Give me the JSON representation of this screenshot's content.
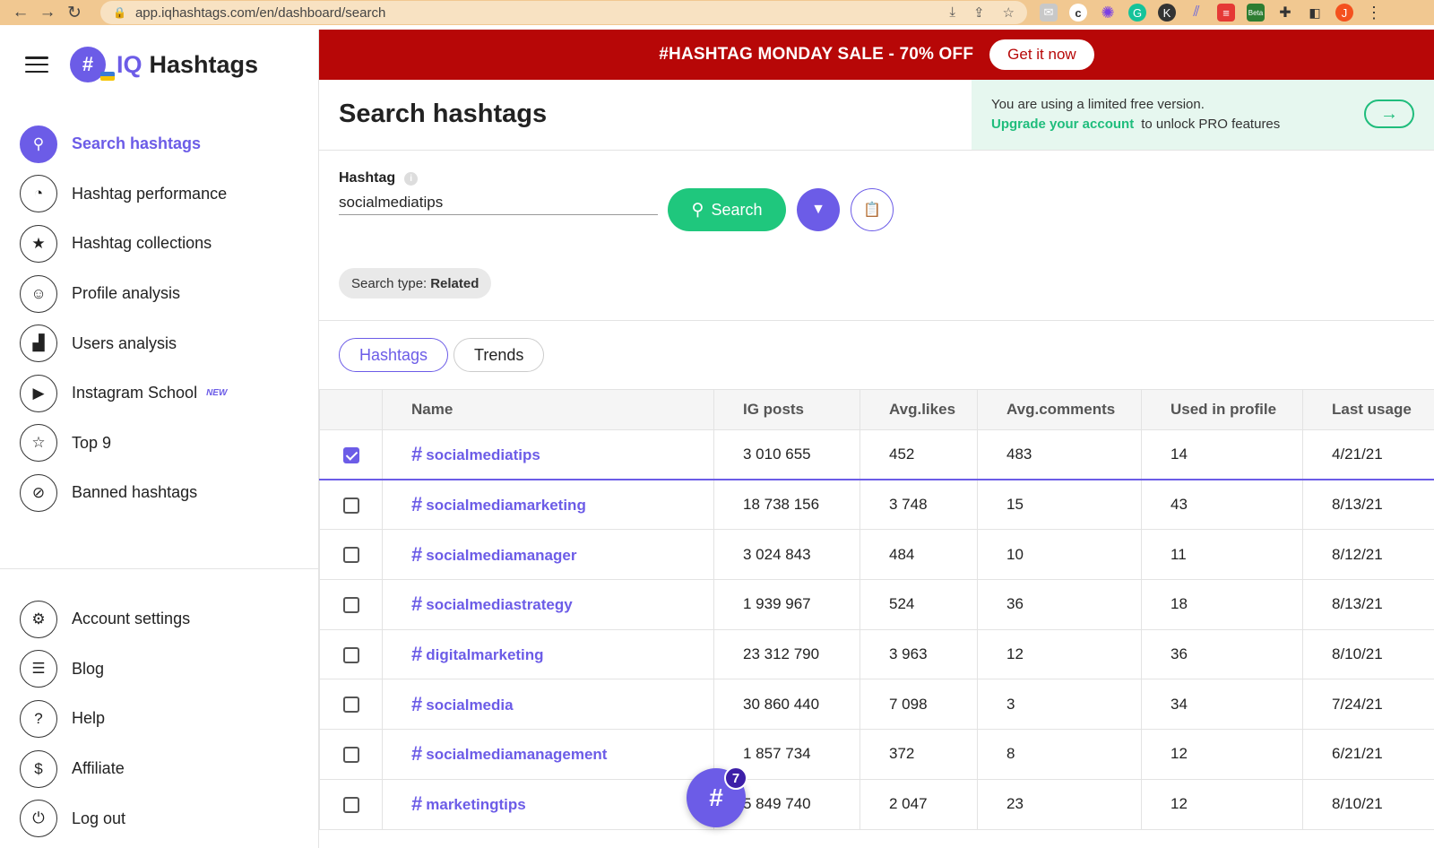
{
  "browser": {
    "url": "app.iqhashtags.com/en/dashboard/search",
    "back_glyph": "←",
    "forward_glyph": "→",
    "reload_glyph": "↻",
    "ext_beta_label": "Beta",
    "avatar_letter": "J"
  },
  "brand": {
    "iq": "IQ",
    "name": "Hashtags",
    "mark": "#"
  },
  "sidebar": {
    "items": [
      {
        "label": "Search hashtags",
        "icon": "search-icon",
        "active": true
      },
      {
        "label": "Hashtag performance",
        "icon": "gauge-icon"
      },
      {
        "label": "Hashtag collections",
        "icon": "folder-star-icon"
      },
      {
        "label": "Profile analysis",
        "icon": "face-icon"
      },
      {
        "label": "Users analysis",
        "icon": "chart-icon"
      },
      {
        "label": "Instagram School",
        "icon": "play-icon",
        "badge": "NEW"
      },
      {
        "label": "Top 9",
        "icon": "star-icon"
      },
      {
        "label": "Banned hashtags",
        "icon": "ban-icon"
      }
    ],
    "bottom_items": [
      {
        "label": "Account settings",
        "icon": "gear-icon"
      },
      {
        "label": "Blog",
        "icon": "document-icon"
      },
      {
        "label": "Help",
        "icon": "question-icon"
      },
      {
        "label": "Affiliate",
        "icon": "dollar-icon"
      },
      {
        "label": "Log out",
        "icon": "power-icon"
      }
    ]
  },
  "banner": {
    "text": "#HASHTAG MONDAY SALE - 70% OFF",
    "button": "Get it now"
  },
  "page": {
    "title": "Search hashtags"
  },
  "notice": {
    "line1": "You are using a limited free version.",
    "link": "Upgrade your account",
    "line2": "to unlock PRO features"
  },
  "search": {
    "label": "Hashtag",
    "value": "socialmediatips",
    "button": "Search",
    "type_prefix": "Search type:",
    "type_value": "Related"
  },
  "tabs": [
    {
      "label": "Hashtags",
      "active": true
    },
    {
      "label": "Trends"
    }
  ],
  "table": {
    "columns": [
      "Name",
      "IG posts",
      "Avg.likes",
      "Avg.comments",
      "Used in profile",
      "Last usage"
    ],
    "rows": [
      {
        "checked": true,
        "name": "socialmediatips",
        "posts": "3 010 655",
        "likes": "452",
        "comments": "483",
        "used": "14",
        "last": "4/21/21"
      },
      {
        "checked": false,
        "name": "socialmediamarketing",
        "posts": "18 738 156",
        "likes": "3 748",
        "comments": "15",
        "used": "43",
        "last": "8/13/21"
      },
      {
        "checked": false,
        "name": "socialmediamanager",
        "posts": "3 024 843",
        "likes": "484",
        "comments": "10",
        "used": "11",
        "last": "8/12/21"
      },
      {
        "checked": false,
        "name": "socialmediastrategy",
        "posts": "1 939 967",
        "likes": "524",
        "comments": "36",
        "used": "18",
        "last": "8/13/21"
      },
      {
        "checked": false,
        "name": "digitalmarketing",
        "posts": "23 312 790",
        "likes": "3 963",
        "comments": "12",
        "used": "36",
        "last": "8/10/21"
      },
      {
        "checked": false,
        "name": "socialmedia",
        "posts": "30 860 440",
        "likes": "7 098",
        "comments": "3",
        "used": "34",
        "last": "7/24/21"
      },
      {
        "checked": false,
        "name": "socialmediamanagement",
        "posts": "1 857 734",
        "likes": "372",
        "comments": "8",
        "used": "12",
        "last": "6/21/21"
      },
      {
        "checked": false,
        "name": "marketingtips",
        "posts": "5 849 740",
        "likes": "2 047",
        "comments": "23",
        "used": "12",
        "last": "8/10/21"
      }
    ]
  },
  "fab": {
    "glyph": "#",
    "count": "7"
  },
  "colors": {
    "accent": "#6c5ce7",
    "green": "#1fc77d",
    "sale_red": "#b70707"
  }
}
